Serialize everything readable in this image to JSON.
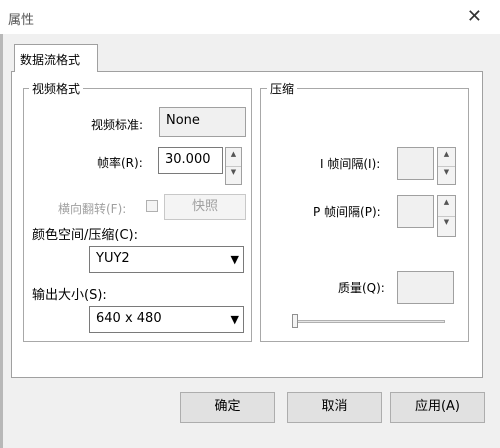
{
  "window": {
    "title": "属性",
    "close_glyph": "✕"
  },
  "tabs": [
    {
      "label": "数据流格式"
    }
  ],
  "video_format": {
    "group_label": "视频格式",
    "standard": {
      "label": "视频标准:",
      "value": "None"
    },
    "frame_rate": {
      "label": "帧率(R):",
      "value": "30.000"
    },
    "flip": {
      "label": "横向翻转(F):",
      "snapshot_label": "快照"
    },
    "color_space": {
      "label": "颜色空间/压缩(C):",
      "value": "YUY2"
    },
    "output_size": {
      "label": "输出大小(S):",
      "value": "640 x 480"
    }
  },
  "compression": {
    "group_label": "压缩",
    "i_frame": {
      "label": "I 帧间隔(I):",
      "value": ""
    },
    "p_frame": {
      "label": "P 帧间隔(P):",
      "value": ""
    },
    "quality": {
      "label": "质量(Q):",
      "value": ""
    }
  },
  "buttons": {
    "ok": "确定",
    "cancel": "取消",
    "apply": "应用(A)"
  },
  "colors": {
    "disabled_text": "#a0a0a0",
    "page_bg": "#ffffff",
    "dialog_bg": "#f0f0f0"
  }
}
